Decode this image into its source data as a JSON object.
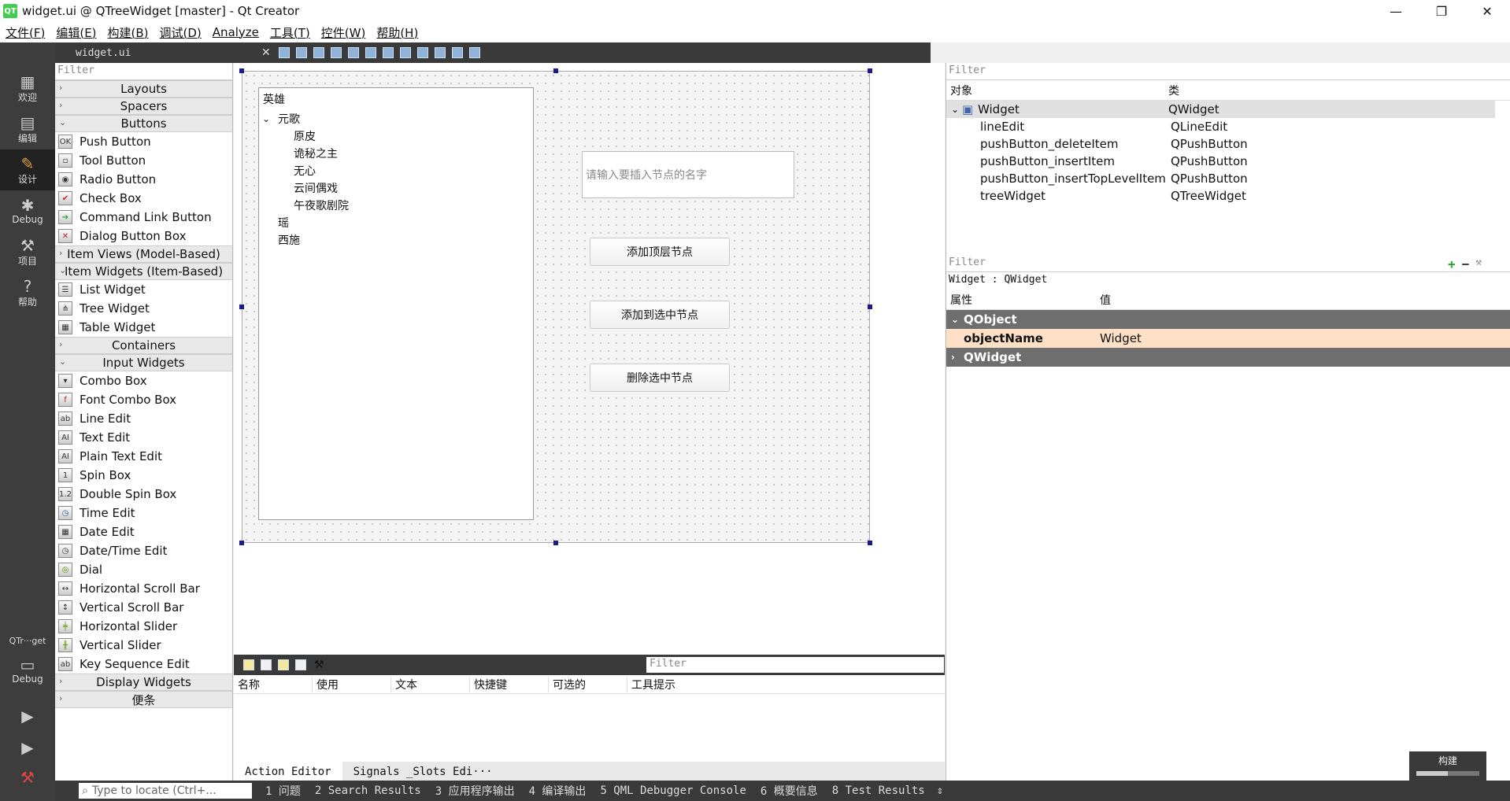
{
  "window": {
    "title": "widget.ui @ QTreeWidget [master] - Qt Creator",
    "logo": "QT"
  },
  "menu": [
    "文件(F)",
    "编辑(E)",
    "构建(B)",
    "调试(D)",
    "Analyze",
    "工具(T)",
    "控件(W)",
    "帮助(H)"
  ],
  "modes": {
    "welcome": "欢迎",
    "edit": "编辑",
    "design": "设计",
    "debug": "Debug",
    "projects": "项目",
    "help": "帮助",
    "target": "QTr···get",
    "target_mode": "Debug"
  },
  "editor": {
    "file": "widget.ui"
  },
  "widgetbox": {
    "filter": "Filter",
    "layouts": "Layouts",
    "spacers": "Spacers",
    "buttons": "Buttons",
    "button_items": [
      "Push Button",
      "Tool Button",
      "Radio Button",
      "Check Box",
      "Command Link Button",
      "Dialog Button Box"
    ],
    "item_views": "Item Views (Model-Based)",
    "item_widgets": "Item Widgets (Item-Based)",
    "item_widget_items": [
      "List Widget",
      "Tree Widget",
      "Table Widget"
    ],
    "containers": "Containers",
    "input_widgets": "Input Widgets",
    "input_items": [
      "Combo Box",
      "Font Combo Box",
      "Line Edit",
      "Text Edit",
      "Plain Text Edit",
      "Spin Box",
      "Double Spin Box",
      "Time Edit",
      "Date Edit",
      "Date/Time Edit",
      "Dial",
      "Horizontal Scroll Bar",
      "Vertical Scroll Bar",
      "Horizontal Slider",
      "Vertical Slider",
      "Key Sequence Edit"
    ],
    "display_widgets": "Display Widgets",
    "notes": "便条"
  },
  "form": {
    "tree_header": "英雄",
    "tree": {
      "parent": "元歌",
      "children": [
        "原皮",
        "诡秘之主",
        "无心",
        "云间偶戏",
        "午夜歌剧院"
      ],
      "top": [
        "瑶",
        "西施"
      ]
    },
    "line_edit_placeholder": "请输入要插入节点的名字",
    "btn_insert_top": "添加顶层节点",
    "btn_insert": "添加到选中节点",
    "btn_delete": "删除选中节点"
  },
  "action_editor": {
    "filter": "Filter",
    "columns": [
      "名称",
      "使用",
      "文本",
      "快捷键",
      "可选的",
      "工具提示"
    ],
    "tabs": [
      "Action Editor",
      "Signals _Slots Edi···"
    ]
  },
  "object_inspector": {
    "filter": "Filter",
    "col_object": "对象",
    "col_class": "类",
    "rows": [
      {
        "name": "Widget",
        "class": "QWidget"
      },
      {
        "name": "lineEdit",
        "class": "QLineEdit"
      },
      {
        "name": "pushButton_deleteItem",
        "class": "QPushButton"
      },
      {
        "name": "pushButton_insertItem",
        "class": "QPushButton"
      },
      {
        "name": "pushButton_insertTopLevelItem",
        "class": "QPushButton"
      },
      {
        "name": "treeWidget",
        "class": "QTreeWidget"
      }
    ]
  },
  "property_editor": {
    "filter": "Filter",
    "context": "Widget : QWidget",
    "col_prop": "属性",
    "col_value": "值",
    "group_qobject": "QObject",
    "prop_name": "objectName",
    "prop_value": "Widget",
    "group_qwidget": "QWidget"
  },
  "status": {
    "locate_placeholder": "Type to locate (Ctrl+...",
    "tabs": [
      "1 问题",
      "2 Search Results",
      "3 应用程序输出",
      "4 编译输出",
      "5 QML Debugger Console",
      "6 概要信息",
      "8 Test Results"
    ],
    "build_label": "构建",
    "build_progress": 0.5
  },
  "colors": {
    "accent": "#e8a33a",
    "selection": "#1a1a8a",
    "prop_highlight": "#fde0c5",
    "group": "#6e6e6e"
  }
}
